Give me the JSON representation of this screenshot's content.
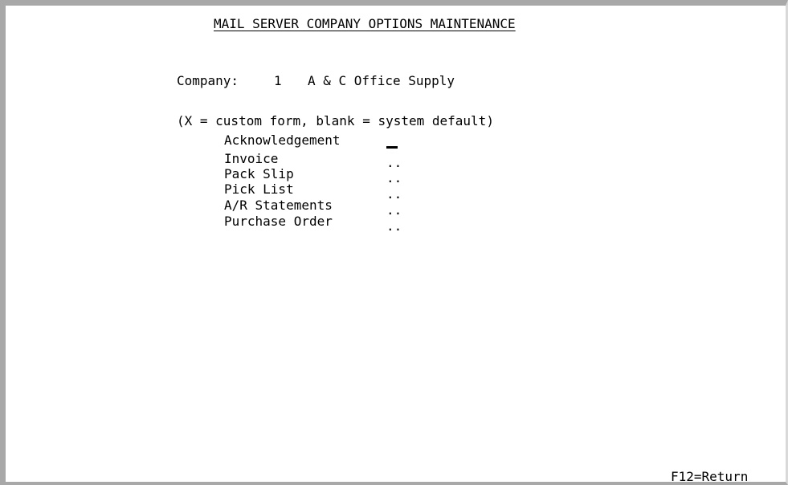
{
  "screen": {
    "title": "MAIL SERVER COMPANY OPTIONS MAINTENANCE",
    "company_label": "Company:",
    "company_number": "1",
    "company_name": "A & C Office Supply",
    "legend": "(X = custom form, blank = system default)"
  },
  "forms": [
    {
      "label": "Acknowledgement",
      "value": "",
      "active": true
    },
    {
      "label": "Invoice",
      "value": "",
      "placeholder": ".."
    },
    {
      "label": "Pack Slip",
      "value": "",
      "placeholder": ".."
    },
    {
      "label": "Pick List",
      "value": "",
      "placeholder": ".."
    },
    {
      "label": "A/R Statements",
      "value": "",
      "placeholder": ".."
    },
    {
      "label": "Purchase Order",
      "value": "",
      "placeholder": ".."
    }
  ],
  "function_keys": {
    "f12": "F12=Return"
  }
}
